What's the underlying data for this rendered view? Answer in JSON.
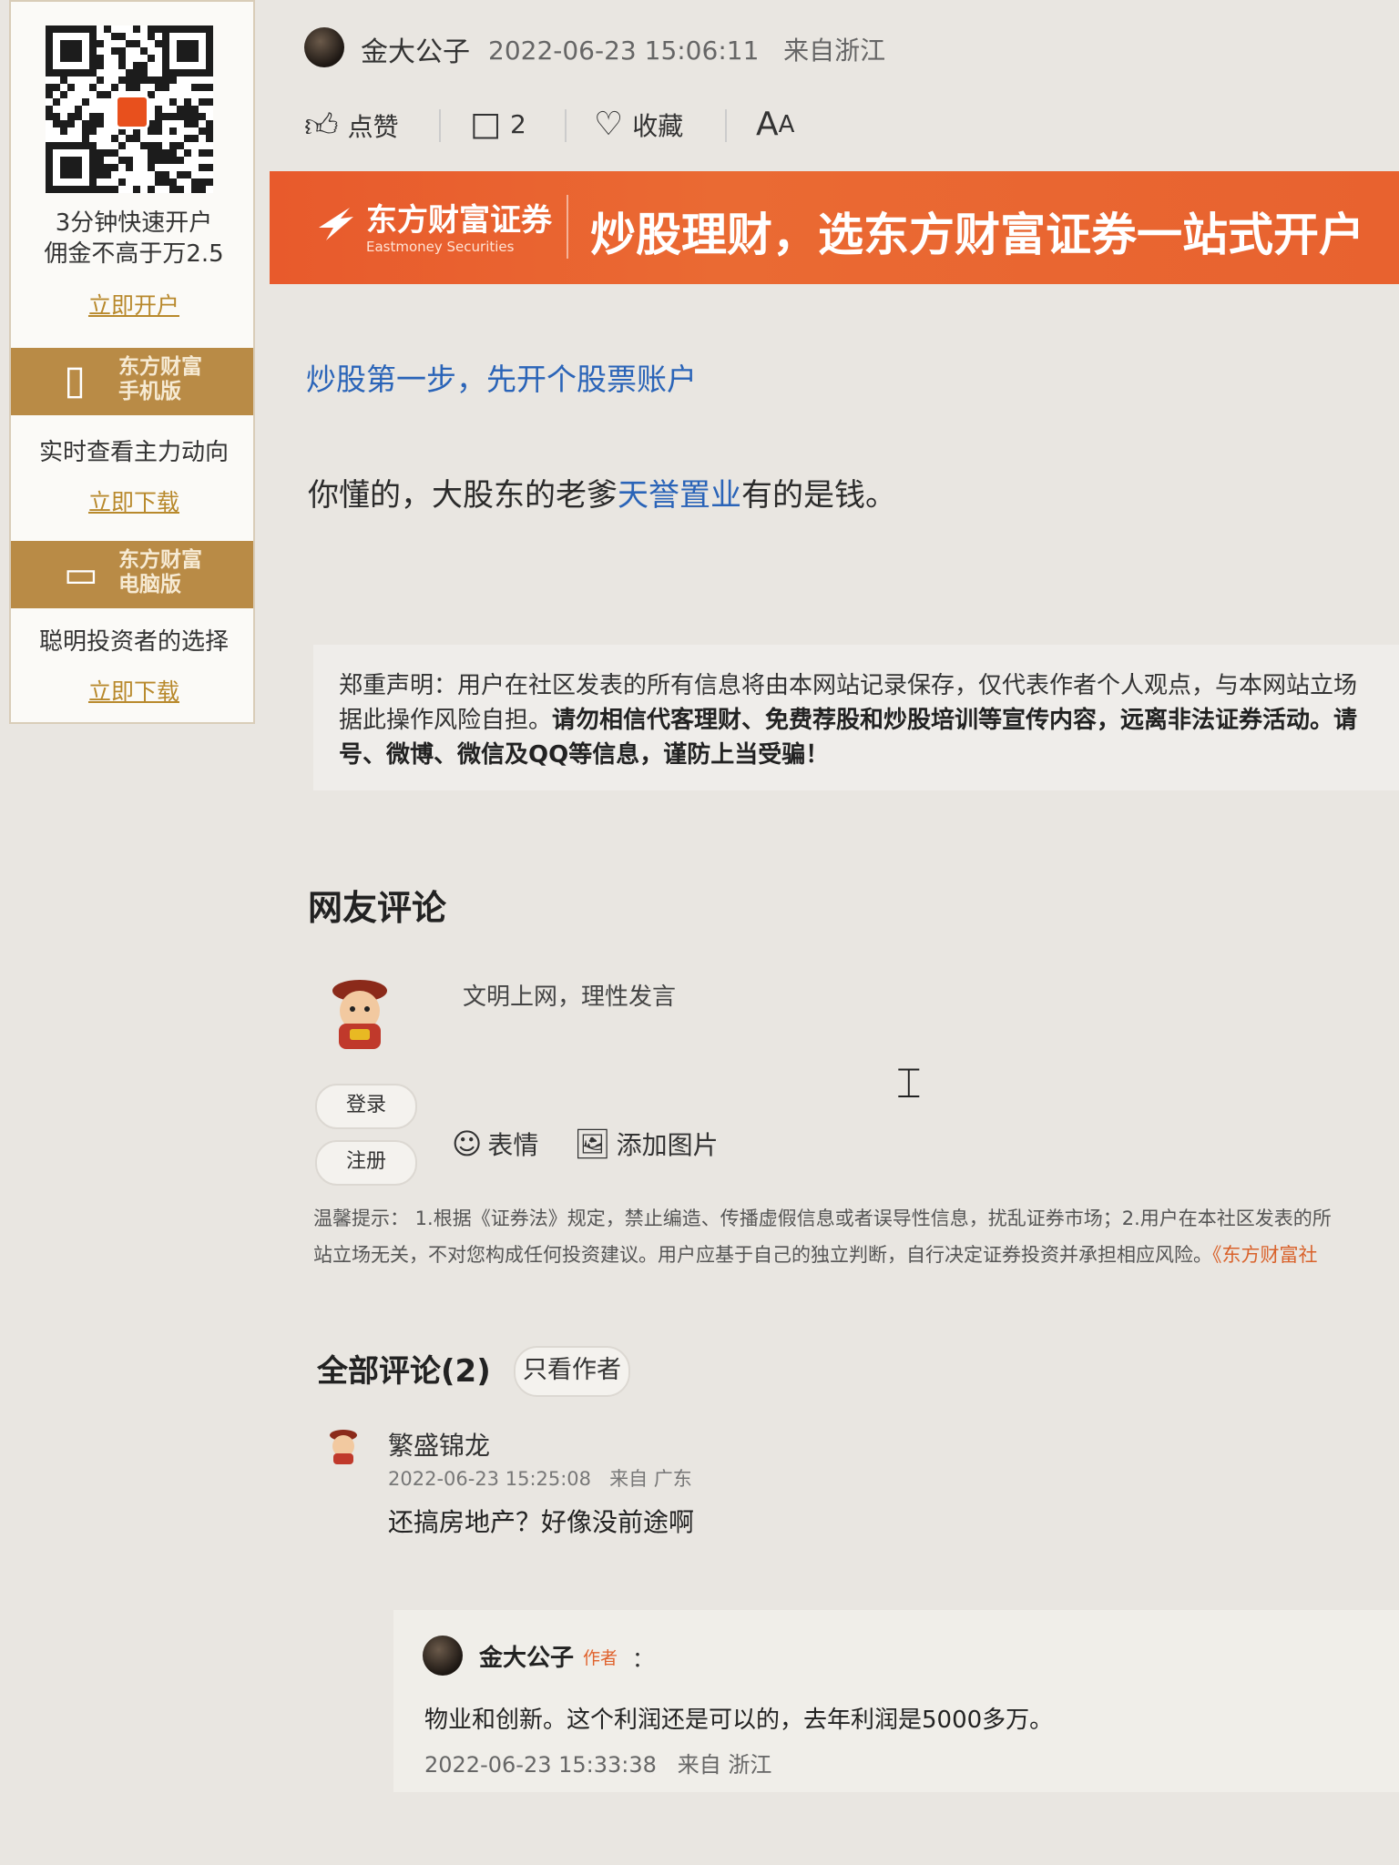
{
  "sidebar": {
    "promo1_line1": "3分钟快速开户",
    "promo1_line2": "佣金不高于万2.5",
    "promo1_link": "立即开户",
    "band1_title_l1": "东方财富",
    "band1_title_l2": "手机版",
    "promo2_text": "实时查看主力动向",
    "promo2_link": "立即下载",
    "band2_title_l1": "东方财富",
    "band2_title_l2": "电脑版",
    "promo3_text": "聪明投资者的选择",
    "promo3_link": "立即下载"
  },
  "post": {
    "author": "金大公子",
    "datetime": "2022-06-23 15:06:11",
    "location": "来自浙江",
    "like_label": "点赞",
    "comment_count": "2",
    "favorite_label": "收藏",
    "font_label": "A",
    "font_label_small": "A",
    "promo_link": "炒股第一步，先开个股票账户",
    "text_before": "你懂的，大股东的老爹",
    "stock_name": "天誉置业",
    "text_after": "有的是钱。"
  },
  "banner": {
    "brand_cn": "东方财富证券",
    "brand_en": "Eastmoney Securities",
    "slogan": "炒股理财，选东方财富证券一站式开户"
  },
  "disclaimer": {
    "line1": "郑重声明：用户在社区发表的所有信息将由本网站记录保存，仅代表作者个人观点，与本网站立场",
    "line2_normal": "据此操作风险自担。",
    "line2_bold": "请勿相信代客理财、免费荐股和炒股培训等宣传内容，远离非法证券活动。请",
    "line3_bold": "号、微博、微信及QQ等信息，谨防上当受骗！"
  },
  "comment_box": {
    "section_title": "网友评论",
    "placeholder": "文明上网，理性发言",
    "login_label": "登录",
    "register_label": "注册",
    "emoji_label": "表情",
    "image_label": "添加图片"
  },
  "tips": {
    "line1": "温馨提示： 1.根据《证券法》规定，禁止编造、传播虚假信息或者误导性信息，扰乱证券市场；2.用户在本社区发表的所",
    "line2": "站立场无关，不对您构成任何投资建议。用户应基于自己的独立判断，自行决定证券投资并承担相应风险。",
    "line2_link": "《东方财富社"
  },
  "comments": {
    "title": "全部评论(2)",
    "only_author": "只看作者",
    "items": [
      {
        "name": "繁盛锦龙",
        "datetime": "2022-06-23 15:25:08",
        "location": "来自 广东",
        "text": "还搞房地产？好像没前途啊",
        "reply": {
          "name": "金大公子",
          "badge": "作者",
          "colon": "：",
          "text": "物业和创新。这个利润还是可以的，去年利润是5000多万。",
          "datetime": "2022-06-23 15:33:38",
          "location": "来自 浙江"
        }
      }
    ]
  },
  "colors": {
    "accent_orange": "#e85a2c",
    "link_blue": "#2a64b8",
    "gold": "#b98b46"
  }
}
